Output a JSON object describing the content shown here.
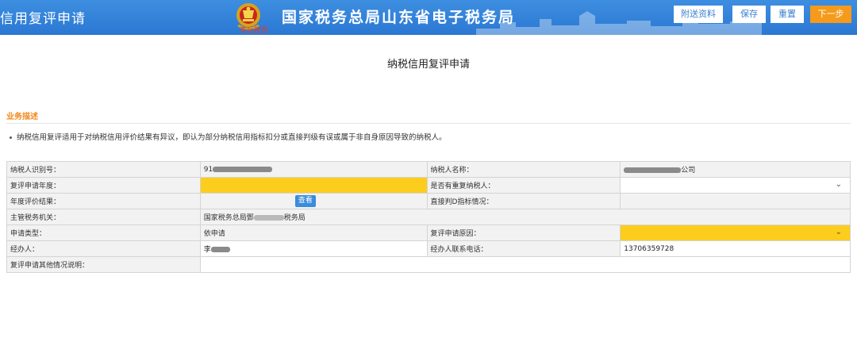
{
  "header": {
    "app_title": "信用复评申请",
    "org_name": "国家税务总局山东省电子税务局",
    "signature": "李后税务",
    "buttons": {
      "attach": "附送资料",
      "save": "保存",
      "reset": "重置",
      "next": "下一步"
    }
  },
  "page_title": "纳税信用复评申请",
  "business": {
    "section_title": "业务描述",
    "description": "纳税信用复评适用于对纳税信用评价结果有异议，即认为部分纳税信用指标扣分或直接判级有误或属于非自身原因导致的纳税人。"
  },
  "form": {
    "taxpayer_id_label": "纳税人识别号：",
    "taxpayer_id_value": "91",
    "taxpayer_name_label": "纳税人名称：",
    "taxpayer_name_suffix": "公司",
    "review_year_label": "复评申请年度：",
    "review_year_value": "",
    "duplicate_label": "是否有重复纳税人：",
    "duplicate_value": "",
    "annual_result_label": "年度评价结果：",
    "view_button": "查看",
    "direct_d_label": "直接判D指标情况：",
    "authority_label": "主管税务机关：",
    "authority_prefix": "国家税务总局鄄",
    "authority_suffix": "税务局",
    "apply_type_label": "申请类型：",
    "apply_type_value": "依申请",
    "reason_label": "复评申请原因：",
    "reason_value": "",
    "handler_label": "经办人：",
    "handler_value": "李",
    "phone_label": "经办人联系电话：",
    "phone_value": "13706359728",
    "other_label": "复评申请其他情况说明：",
    "other_value": ""
  },
  "colors": {
    "header_blue": "#2b78d3",
    "accent_orange": "#f59a1b",
    "required_yellow": "#fccd1c",
    "section_orange": "#f08a1c"
  },
  "icons": {
    "dropdown": "chevron-down-icon",
    "emblem": "tax-emblem-icon"
  }
}
